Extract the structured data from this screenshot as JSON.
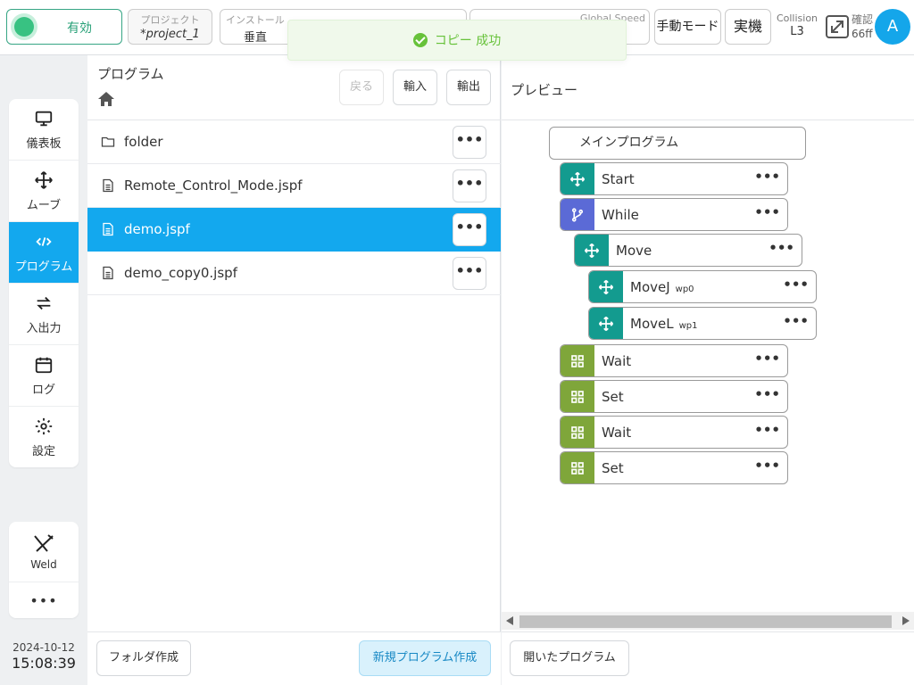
{
  "topbar": {
    "enable_label": "有効",
    "project": {
      "label": "プロジェクト",
      "value": "*project_1"
    },
    "install": {
      "label": "インストール",
      "value": "垂直"
    },
    "speed_label": "Global Speed",
    "manual_mode": "手動モード",
    "real_robot": "実機",
    "collision": {
      "label": "Collision",
      "value": "L3"
    },
    "confirm": {
      "label": "確認",
      "value": "66ff"
    },
    "avatar": "A"
  },
  "toast": {
    "message": "コピー 成功"
  },
  "nav": {
    "items": [
      {
        "label": "儀表板",
        "icon": "monitor-icon"
      },
      {
        "label": "ムーブ",
        "icon": "move-arrows-icon"
      },
      {
        "label": "プログラム",
        "icon": "code-icon",
        "active": true
      },
      {
        "label": "入出力",
        "icon": "swap-icon"
      },
      {
        "label": "ログ",
        "icon": "calendar-icon"
      },
      {
        "label": "設定",
        "icon": "gear-icon"
      }
    ],
    "weld_label": "Weld",
    "more_label": "•••"
  },
  "clock": {
    "date": "2024-10-12",
    "time": "15:08:39"
  },
  "program": {
    "title": "プログラム",
    "back": "戻る",
    "import": "輸入",
    "export": "輸出",
    "files": [
      {
        "name": "folder",
        "type": "folder"
      },
      {
        "name": "Remote_Control_Mode.jspf",
        "type": "file"
      },
      {
        "name": "demo.jspf",
        "type": "file",
        "selected": true
      },
      {
        "name": "demo_copy0.jspf",
        "type": "file"
      }
    ],
    "more_label": "•••",
    "create_folder": "フォルダ作成",
    "create_program": "新規プログラム作成"
  },
  "preview": {
    "title": "プレビュー",
    "main": "メインプログラム",
    "nodes": [
      {
        "label": "Start",
        "sub": "",
        "kind": "move"
      },
      {
        "label": "While",
        "sub": "",
        "kind": "branch"
      },
      {
        "label": "Move",
        "sub": "",
        "kind": "move"
      },
      {
        "label": "MoveJ",
        "sub": "wp0",
        "kind": "move"
      },
      {
        "label": "MoveL",
        "sub": "wp1",
        "kind": "move"
      },
      {
        "label": "Wait",
        "sub": "",
        "kind": "grid"
      },
      {
        "label": "Set",
        "sub": "",
        "kind": "grid"
      },
      {
        "label": "Wait",
        "sub": "",
        "kind": "grid"
      },
      {
        "label": "Set",
        "sub": "",
        "kind": "grid"
      }
    ],
    "more_label": "•••",
    "opened_programs": "開いたプログラム"
  },
  "colors": {
    "accent": "#13a8ee",
    "enable_green": "#36a584",
    "move_teal": "#139b8f",
    "branch_purple": "#5b6ad6",
    "grid_olive": "#7fa63a",
    "success": "#67c23a"
  }
}
